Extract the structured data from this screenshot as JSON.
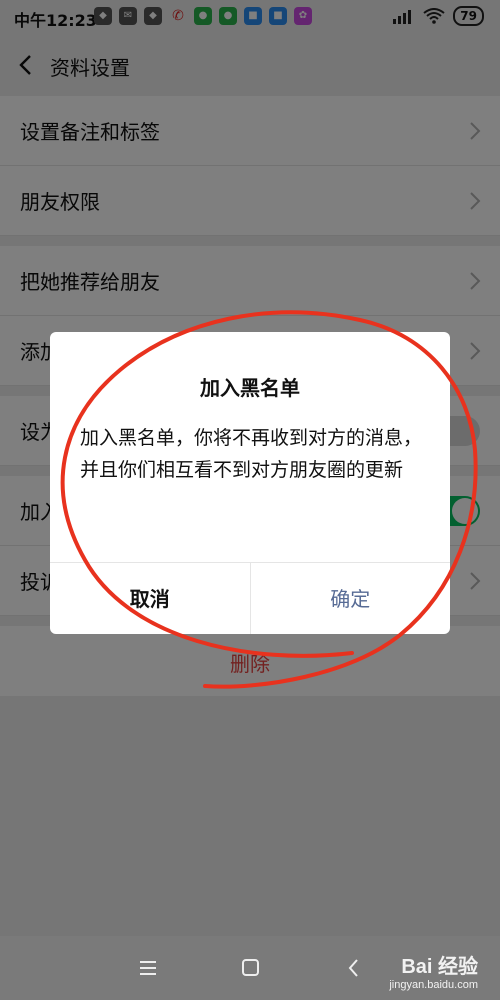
{
  "status_bar": {
    "time": "中午12:23",
    "battery": "79"
  },
  "header": {
    "title": "资料设置"
  },
  "rows": [
    {
      "label": "设置备注和标签"
    },
    {
      "label": "朋友权限"
    },
    {
      "label": "把她推荐给朋友"
    },
    {
      "label": "添加到桌面"
    },
    {
      "label": "设为星标朋友"
    },
    {
      "label": "加入黑名单"
    },
    {
      "label": "投诉"
    }
  ],
  "delete_label": "删除",
  "dialog": {
    "title": "加入黑名单",
    "message": "加入黑名单，你将不再收到对方的消息，并且你们相互看不到对方朋友圈的更新",
    "cancel_label": "取消",
    "confirm_label": "确定"
  },
  "watermark": {
    "main": "Bai 经验",
    "sub": "jingyan.baidu.com"
  },
  "colors": {
    "accent_green": "#07c160",
    "confirm_blue": "#576b95",
    "annotation_red": "#e8321e"
  }
}
